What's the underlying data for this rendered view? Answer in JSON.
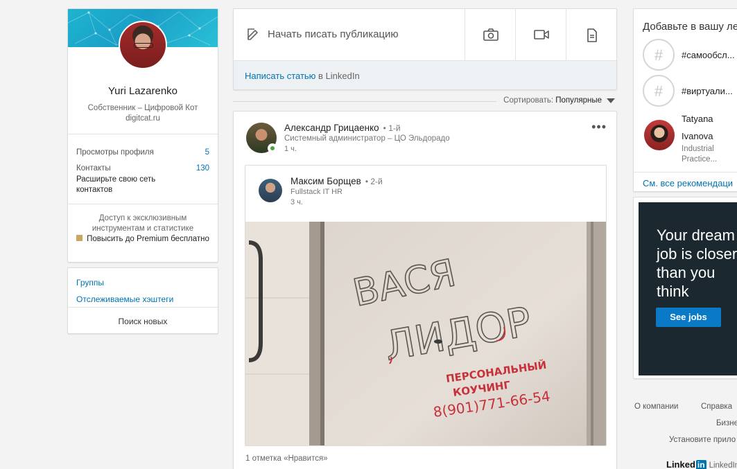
{
  "profile": {
    "name": "Yuri Lazarenko",
    "headline": "Собственник – Цифровой Кот digitcat.ru",
    "views_label": "Просмотры профиля",
    "views_count": "5",
    "contacts_label": "Контакты",
    "contacts_count": "130",
    "contacts_sub": "Расширьте свою сеть контактов",
    "premium_text": "Доступ к эксклюзивным инструментам и статистике",
    "premium_link": "Повысить до Premium бесплатно"
  },
  "left_links": {
    "groups": "Группы",
    "hashtags": "Отслеживаемые хэштеги",
    "find_new": "Поиск новых"
  },
  "share": {
    "start_post": "Начать писать публикацию",
    "write_article_link": "Написать статью",
    "write_article_suffix": " в LinkedIn",
    "icons": [
      "camera-icon",
      "video-icon",
      "document-icon"
    ]
  },
  "sort": {
    "label": "Сортировать: ",
    "value": "Популярные"
  },
  "post": {
    "actor_name": "Александр Грицаенко",
    "actor_degree": "• 1-й",
    "actor_desc": "Системный администратор – ЦО Эльдорадо",
    "actor_time": "1 ч.",
    "menu": "•••",
    "reshared_name": "Максим Борщев",
    "reshared_degree": "• 2-й",
    "reshared_desc": "Fullstack IT HR",
    "reshared_time": "3 ч.",
    "image_text_1": "ВАСЯ",
    "image_text_2": "ЛИДОР",
    "image_text_3": "ПЕРСОНАЛЬНЫЙ",
    "image_text_4": "КОУЧИНГ",
    "image_text_5": "8(901)771-66-54",
    "likes": "1 отметка «Нравится»"
  },
  "recommendations": {
    "title": "Добавьте в вашу ле",
    "hashtag_1": "#самообсл...",
    "hashtag_2": "#виртуали...",
    "person_first": "Tatyana",
    "person_last": "Ivanova",
    "person_title": "Industrial Practice...",
    "see_all": "См. все рекомендаци"
  },
  "ad": {
    "line1": "Your dream",
    "line2": "job is closer",
    "line3": "than you",
    "line4": "think",
    "button": "See jobs"
  },
  "footer": {
    "about": "О компании",
    "help": "Справка",
    "business": "Бизне",
    "install": "Установите прило",
    "brand": "Linked",
    "brand_in": "in",
    "brand_corp": "LinkedIn"
  },
  "colors": {
    "link": "#0073b1",
    "online": "#4aa33c",
    "ad_bg": "#1b2830",
    "ad_button": "#0a7ac7",
    "premium": "#c9a75d"
  }
}
